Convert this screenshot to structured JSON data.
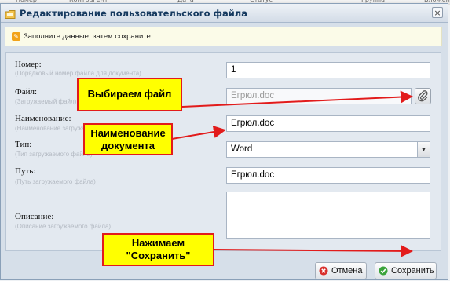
{
  "background_header": {
    "columns": [
      "Номер",
      "Контрагент",
      "Дата",
      "Статус",
      "Группа",
      "Вложение"
    ]
  },
  "dialog": {
    "title": "Редактирование пользовательского файла",
    "close_glyph": "×",
    "notice": "Заполните данные, затем сохраните"
  },
  "form": {
    "number": {
      "label": "Номер:",
      "hint": "(Порядковый номер файла для документа)",
      "value": "1"
    },
    "file": {
      "label": "Файл:",
      "hint": "(Загружаемый файл)",
      "value": "Егрюл.doc"
    },
    "name": {
      "label": "Наименование:",
      "hint": "(Наименование загружаемого файла)",
      "value": "Егрюл.doc"
    },
    "type": {
      "label": "Тип:",
      "hint": "(Тип загружаемого файла)",
      "value": "Word"
    },
    "path": {
      "label": "Путь:",
      "hint": "(Путь загружаемого файла)",
      "value": "Егрюл.doc"
    },
    "description": {
      "label": "Описание:",
      "hint": "(Описание загружаемого файла)",
      "value": ""
    }
  },
  "buttons": {
    "cancel": "Отмена",
    "save": "Сохранить"
  },
  "annotations": {
    "choose_file": "Выбираем файл",
    "doc_name_line1": "Наименование",
    "doc_name_line2": "документа",
    "press_save_line1": "Нажимаем",
    "press_save_line2": "\"Сохранить\""
  },
  "colors": {
    "callout_fill": "#ffff00",
    "callout_border": "#e21b1b",
    "arrow": "#e21b1b",
    "title_text": "#15395f"
  }
}
